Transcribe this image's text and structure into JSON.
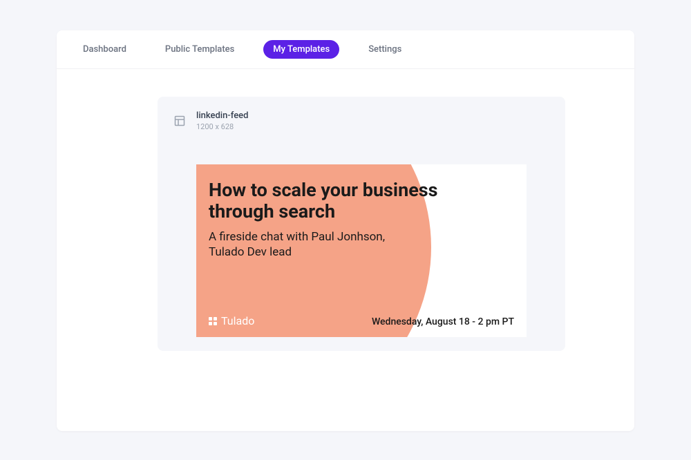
{
  "nav": {
    "tabs": [
      {
        "label": "Dashboard",
        "active": false
      },
      {
        "label": "Public Templates",
        "active": false
      },
      {
        "label": "My Templates",
        "active": true
      },
      {
        "label": "Settings",
        "active": false
      }
    ]
  },
  "template": {
    "name": "linkedin-feed",
    "dimensions": "1200 x 628"
  },
  "preview": {
    "title": "How to scale your business through search",
    "subtitle": "A fireside chat with Paul Jonhson, Tulado Dev lead",
    "brand": "Tulado",
    "date": "Wednesday, August 18 - 2 pm  PT",
    "accent_color": "#f5a387"
  }
}
